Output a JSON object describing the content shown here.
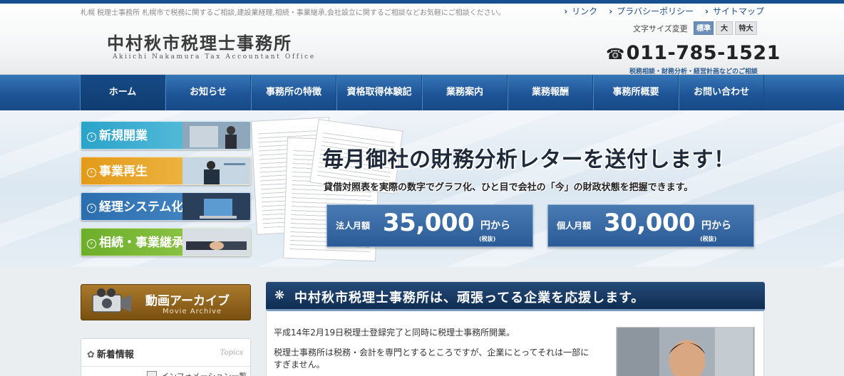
{
  "header": {
    "tagline": "札幌 税理士事務所 札幌市で税務に関するご相談,建設業経理,相続・事業継承,会社設立に関するご相談などお気軽にご相談ください。",
    "top_links": [
      "リンク",
      "プラバシーポリシー",
      "サイトマップ"
    ],
    "logo_jp": "中村秋市税理士事務所",
    "logo_en": "Akiichi Nakamura Tax Accountant Office",
    "font_size_label": "文字サイズ変更",
    "font_size_options": [
      "標準",
      "大",
      "特大"
    ],
    "font_size_selected": "標準",
    "phone": "011-785-1521",
    "phone_icon": "telephone-icon",
    "phone_sub": "税務相談・財務分析・経営計画などのご相談"
  },
  "nav": {
    "items": [
      "ホーム",
      "お知らせ",
      "事務所の特徴",
      "資格取得体験記",
      "業務案内",
      "業務報酬",
      "事務所概要",
      "お問い合わせ"
    ],
    "active": "ホーム"
  },
  "hero": {
    "services": [
      {
        "label": "新規開業",
        "color": "#3fb0d0"
      },
      {
        "label": "事業再生",
        "color": "#e8a020"
      },
      {
        "label": "経理システム化",
        "color": "#2f78b8"
      },
      {
        "label": "相続・事業継承",
        "color": "#7ab830"
      }
    ],
    "headline": "毎月御社の財務分析レターを送付します！",
    "subline": "貸借対照表を実際の数字でグラフ化、ひと目で会社の「今」の財政状態を把握できます。",
    "prices": [
      {
        "label": "法人月額",
        "amount": "35,000",
        "suffix": "円から",
        "tax": "(税抜)"
      },
      {
        "label": "個人月額",
        "amount": "30,000",
        "suffix": "円から",
        "tax": "(税抜)"
      }
    ]
  },
  "sidebar": {
    "movie_title": "動画アーカイブ",
    "movie_sub": "Movie Archive",
    "movie_icon": "video-camera-icon",
    "news_title": "新着情報",
    "news_en": "Topics",
    "news_item": "インフォメーション一覧"
  },
  "main": {
    "heading": "中村秋市税理士事務所は、頑張ってる企業を応援します。",
    "heading_icon": "snowflake-icon",
    "paragraphs": [
      "平成14年2月19日税理士登録完了と同時に税理士事務所開業。",
      "税理士事務所は税務・会計を専門とするところですが、企業にとってそれは一部に",
      "すぎません。"
    ]
  },
  "colors": {
    "brand_blue": "#1e5597",
    "movie_brown": "#8a5e18"
  }
}
